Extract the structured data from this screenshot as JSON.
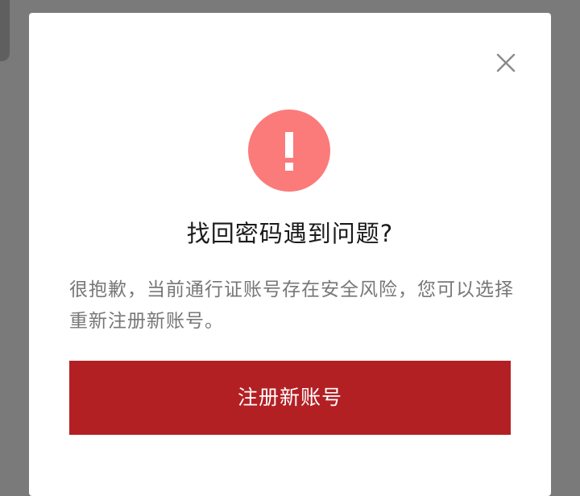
{
  "dialog": {
    "title": "找回密码遇到问题?",
    "message": "很抱歉，当前通行证账号存在安全风险，您可以选择重新注册新账号。",
    "primary_button_label": "注册新账号",
    "alert_icon": "exclamation-icon",
    "close_icon": "close-icon"
  },
  "colors": {
    "alert_circle": "#fb7b7b",
    "primary_button": "#b32024",
    "overlay": "#7a7a7a"
  }
}
